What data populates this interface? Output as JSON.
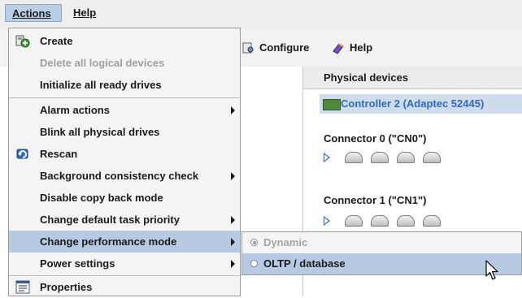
{
  "menubar": {
    "actions": "Actions",
    "help": "Help"
  },
  "toolbar": {
    "configure": "Configure",
    "help": "Help"
  },
  "devices": {
    "header": "Physical devices",
    "controller": "Controller 2 (Adaptec 52445)",
    "connectors": [
      {
        "label": "Connector 0 (\"CN0\")",
        "drives": 4
      },
      {
        "label": "Connector 1 (\"CN1\")",
        "drives": 4
      }
    ]
  },
  "menu": {
    "items": [
      {
        "label": "Create",
        "icon": "create-icon",
        "enabled": true
      },
      {
        "label": "Delete all logical devices",
        "enabled": false
      },
      {
        "label": "Initialize all ready drives",
        "enabled": true
      },
      {
        "label": "Alarm actions",
        "submenu": true
      },
      {
        "label": "Blink all physical drives"
      },
      {
        "label": "Rescan",
        "icon": "rescan-icon"
      },
      {
        "label": "Background consistency check",
        "submenu": true
      },
      {
        "label": "Disable copy back mode"
      },
      {
        "label": "Change default task priority",
        "submenu": true
      },
      {
        "label": "Change performance mode",
        "submenu": true,
        "selected": true
      },
      {
        "label": "Power settings",
        "submenu": true
      },
      {
        "label": "Properties",
        "icon": "properties-icon"
      }
    ]
  },
  "submenu": {
    "items": [
      {
        "label": "Dynamic",
        "enabled": false,
        "checked": true
      },
      {
        "label": "OLTP / database",
        "enabled": true,
        "checked": false,
        "hover": true
      }
    ]
  },
  "colors": {
    "selection": "#b6cbe2",
    "menu_bg": "#f4f4f4",
    "controller_text": "#2b6cc4"
  }
}
